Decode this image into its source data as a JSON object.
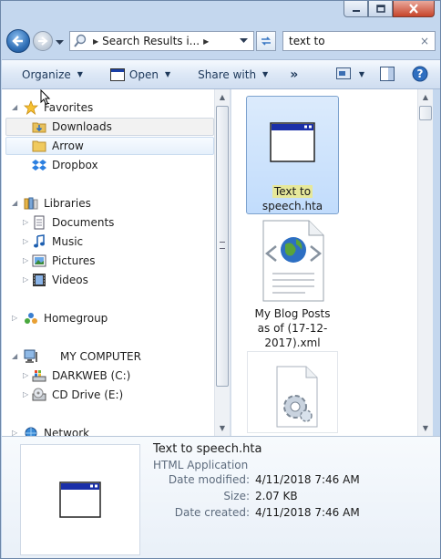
{
  "window": {
    "minimize_icon": "minimize-icon",
    "maximize_icon": "maximize-icon",
    "close_icon": "close-icon"
  },
  "address": {
    "crumb": "Search Results i...",
    "search_value": "text to",
    "search_clear": "×"
  },
  "toolbar": {
    "organize": "Organize",
    "open": "Open",
    "share_with": "Share with",
    "more": "»"
  },
  "nav": {
    "favorites": "Favorites",
    "downloads": "Downloads",
    "arrow": "Arrow",
    "dropbox": "Dropbox",
    "libraries": "Libraries",
    "documents": "Documents",
    "music": "Music",
    "pictures": "Pictures",
    "videos": "Videos",
    "homegroup": "Homegroup",
    "computer": "MY COMPUTER",
    "drive_c": "DARKWEB (C:)",
    "drive_e": "CD Drive (E:)",
    "network": "Network"
  },
  "files": [
    {
      "name_hl": "Text to",
      "name_rest": "speech.hta"
    },
    {
      "name": "My Blog Posts as of (17-12-2017).xml"
    }
  ],
  "details": {
    "name": "Text to speech.hta",
    "type": "HTML Application",
    "modified_label": "Date modified:",
    "modified": "4/11/2018 7:46 AM",
    "size_label": "Size:",
    "size": "2.07 KB",
    "created_label": "Date created:",
    "created": "4/11/2018 7:46 AM"
  },
  "colors": {
    "accent": "#2f6fb6",
    "selection": "#c1dcfc",
    "highlight": "#e6e89a"
  }
}
